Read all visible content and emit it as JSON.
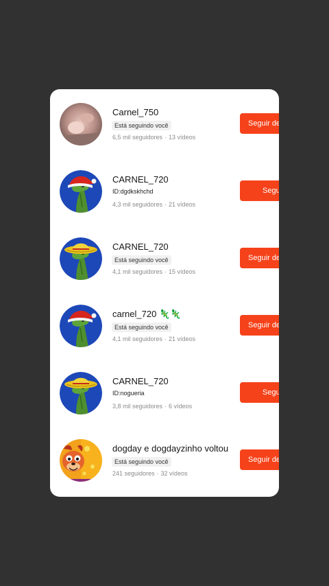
{
  "accounts": [
    {
      "name": "Carnel_750",
      "subtitle": "Está seguindo você",
      "subtitle_is_badge": true,
      "followers": "6,5 mil seguidores",
      "videos": "13  vídeos",
      "button": "Seguir de volta",
      "avatar": "photo-avatar"
    },
    {
      "name": "CARNEL_720",
      "subtitle": "ID:dgdkskhchd",
      "subtitle_is_badge": false,
      "followers": "4,3 mil seguidores",
      "videos": "21  vídeos",
      "button": "Seguir",
      "avatar": "dino-santa-hat-avatar"
    },
    {
      "name": "CARNEL_720",
      "subtitle": "Está seguindo você",
      "subtitle_is_badge": true,
      "followers": "4,1 mil seguidores",
      "videos": "15  vídeos",
      "button": "Seguir de volta",
      "avatar": "dino-straw-hat-avatar"
    },
    {
      "name": "carnel_720 🦎🦎",
      "subtitle": "Está seguindo você",
      "subtitle_is_badge": true,
      "followers": "4,1 mil seguidores",
      "videos": "21  vídeos",
      "button": "Seguir de volta",
      "avatar": "dino-santa-hat-avatar"
    },
    {
      "name": "CARNEL_720",
      "subtitle": "ID:nogueria",
      "subtitle_is_badge": false,
      "followers": "3,8 mil seguidores",
      "videos": "6  vídeos",
      "button": "Seguir",
      "avatar": "dino-straw-hat-avatar"
    },
    {
      "name": "dogday e dogdayzinho voltou",
      "subtitle": "Está seguindo você",
      "subtitle_is_badge": true,
      "followers": "241 seguidores",
      "videos": "32  vídeos",
      "button": "Seguir de volta",
      "avatar": "dogday-avatar"
    }
  ],
  "colors": {
    "background": "#323131",
    "card": "#ffffff",
    "button": "#f6421a"
  }
}
